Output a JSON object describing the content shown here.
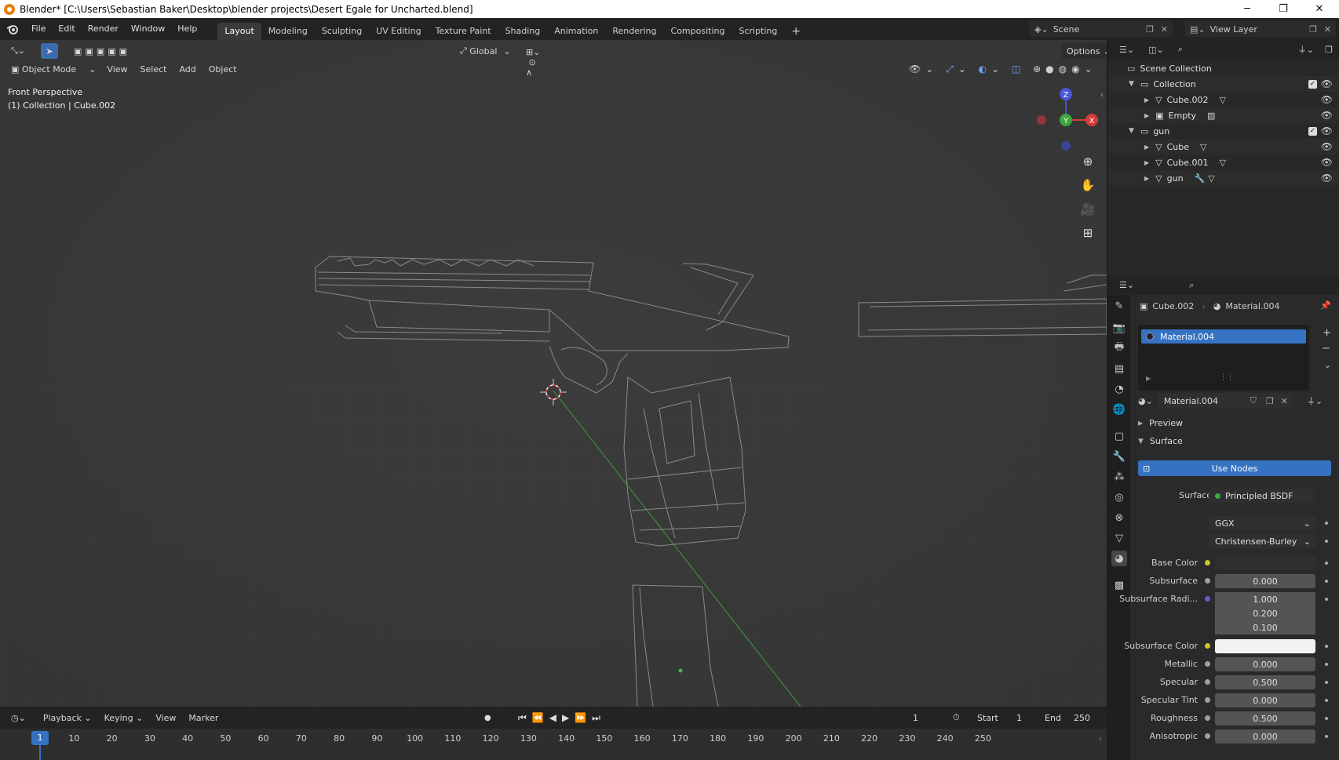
{
  "window": {
    "title": "Blender* [C:\\Users\\Sebastian Baker\\Desktop\\blender projects\\Desert Egale for Uncharted.blend]",
    "minimize": "─",
    "maximize": "❐",
    "close": "✕"
  },
  "menu": [
    "File",
    "Edit",
    "Render",
    "Window",
    "Help"
  ],
  "workspaces": [
    "Layout",
    "Modeling",
    "Sculpting",
    "UV Editing",
    "Texture Paint",
    "Shading",
    "Animation",
    "Rendering",
    "Compositing",
    "Scripting"
  ],
  "add_workspace": "+",
  "scene": {
    "name": "Scene",
    "view_layer": "View Layer"
  },
  "viewport": {
    "transform_orientation": "Global",
    "options_label": "Options",
    "mode": "Object Mode",
    "header_menus": [
      "View",
      "Select",
      "Add",
      "Object"
    ],
    "overlay_title": "Front Perspective",
    "overlay_subtitle": "(1) Collection | Cube.002",
    "gizmo": {
      "z": "Z",
      "y": "Y",
      "x": "X"
    }
  },
  "timeline": {
    "menus": [
      "Playback",
      "Keying",
      "View",
      "Marker"
    ],
    "current_frame": "1",
    "start_label": "Start",
    "start_value": "1",
    "end_label": "End",
    "end_value": "250",
    "ticks": [
      "10",
      "20",
      "30",
      "40",
      "50",
      "60",
      "70",
      "80",
      "90",
      "100",
      "110",
      "120",
      "130",
      "140",
      "150",
      "160",
      "170",
      "180",
      "190",
      "200",
      "210",
      "220",
      "230",
      "240",
      "250"
    ]
  },
  "outliner": {
    "root": "Scene Collection",
    "rows": [
      {
        "name": "Collection",
        "type": "collection"
      },
      {
        "name": "Cube.002",
        "type": "mesh"
      },
      {
        "name": "Empty",
        "type": "empty"
      },
      {
        "name": "gun",
        "type": "collection"
      },
      {
        "name": "Cube",
        "type": "mesh"
      },
      {
        "name": "Cube.001",
        "type": "mesh"
      },
      {
        "name": "gun",
        "type": "mesh"
      }
    ]
  },
  "properties": {
    "breadcrumb_object": "Cube.002",
    "breadcrumb_material": "Material.004",
    "slot_name": "Material.004",
    "material_name": "Material.004",
    "panel_preview": "Preview",
    "panel_surface": "Surface",
    "use_nodes": "Use Nodes",
    "surface_label": "Surface",
    "surface_value": "Principled BSDF",
    "distribution": "GGX",
    "subsurface_method": "Christensen-Burley",
    "fields": [
      {
        "label": "Base Color",
        "value": "",
        "kind": "color"
      },
      {
        "label": "Subsurface",
        "value": "0.000",
        "kind": "num"
      },
      {
        "label": "Subsurface Radi...",
        "value": "1.000",
        "kind": "vec"
      },
      {
        "label": "",
        "value": "0.200",
        "kind": "vec"
      },
      {
        "label": "",
        "value": "0.100",
        "kind": "vec"
      },
      {
        "label": "Subsurface Color",
        "value": "",
        "kind": "color-white"
      },
      {
        "label": "Metallic",
        "value": "0.000",
        "kind": "num"
      },
      {
        "label": "Specular",
        "value": "0.500",
        "kind": "num"
      },
      {
        "label": "Specular Tint",
        "value": "0.000",
        "kind": "num"
      },
      {
        "label": "Roughness",
        "value": "0.500",
        "kind": "num"
      },
      {
        "label": "Anisotropic",
        "value": "0.000",
        "kind": "num"
      }
    ]
  },
  "colors": {
    "accent": "#2f72c8",
    "selected_row": "#3572c2",
    "axis_x": "#d63b3b",
    "axis_y": "#3ea63e",
    "axis_z": "#4a54d6"
  }
}
